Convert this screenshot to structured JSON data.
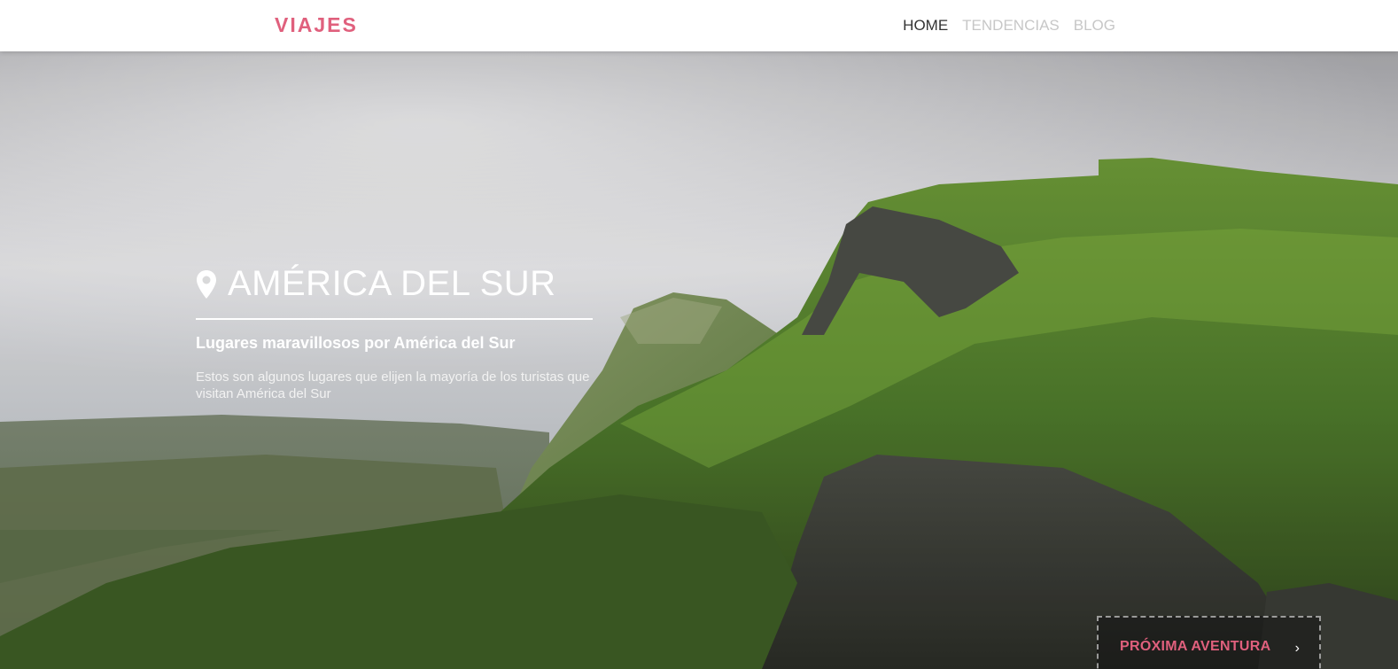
{
  "brand": {
    "logo": "VIAJES",
    "accent_color": "#e0607d"
  },
  "nav": {
    "items": [
      {
        "label": "HOME",
        "active": true
      },
      {
        "label": "TENDENCIAS",
        "active": false
      },
      {
        "label": "BLOG",
        "active": false
      }
    ]
  },
  "hero": {
    "icon": "map-pin-icon",
    "title": "AMÉRICA DEL SUR",
    "subtitle": "Lugares maravillosos por América del Sur",
    "description": "Estos son algunos lugares que elijen la mayoría de los turistas que visitan América del Sur",
    "background": "misty green mountain cliffs under cloudy sky"
  },
  "cta": {
    "label": "PRÓXIMA AVENTURA",
    "icon": "chevron-right-icon"
  }
}
